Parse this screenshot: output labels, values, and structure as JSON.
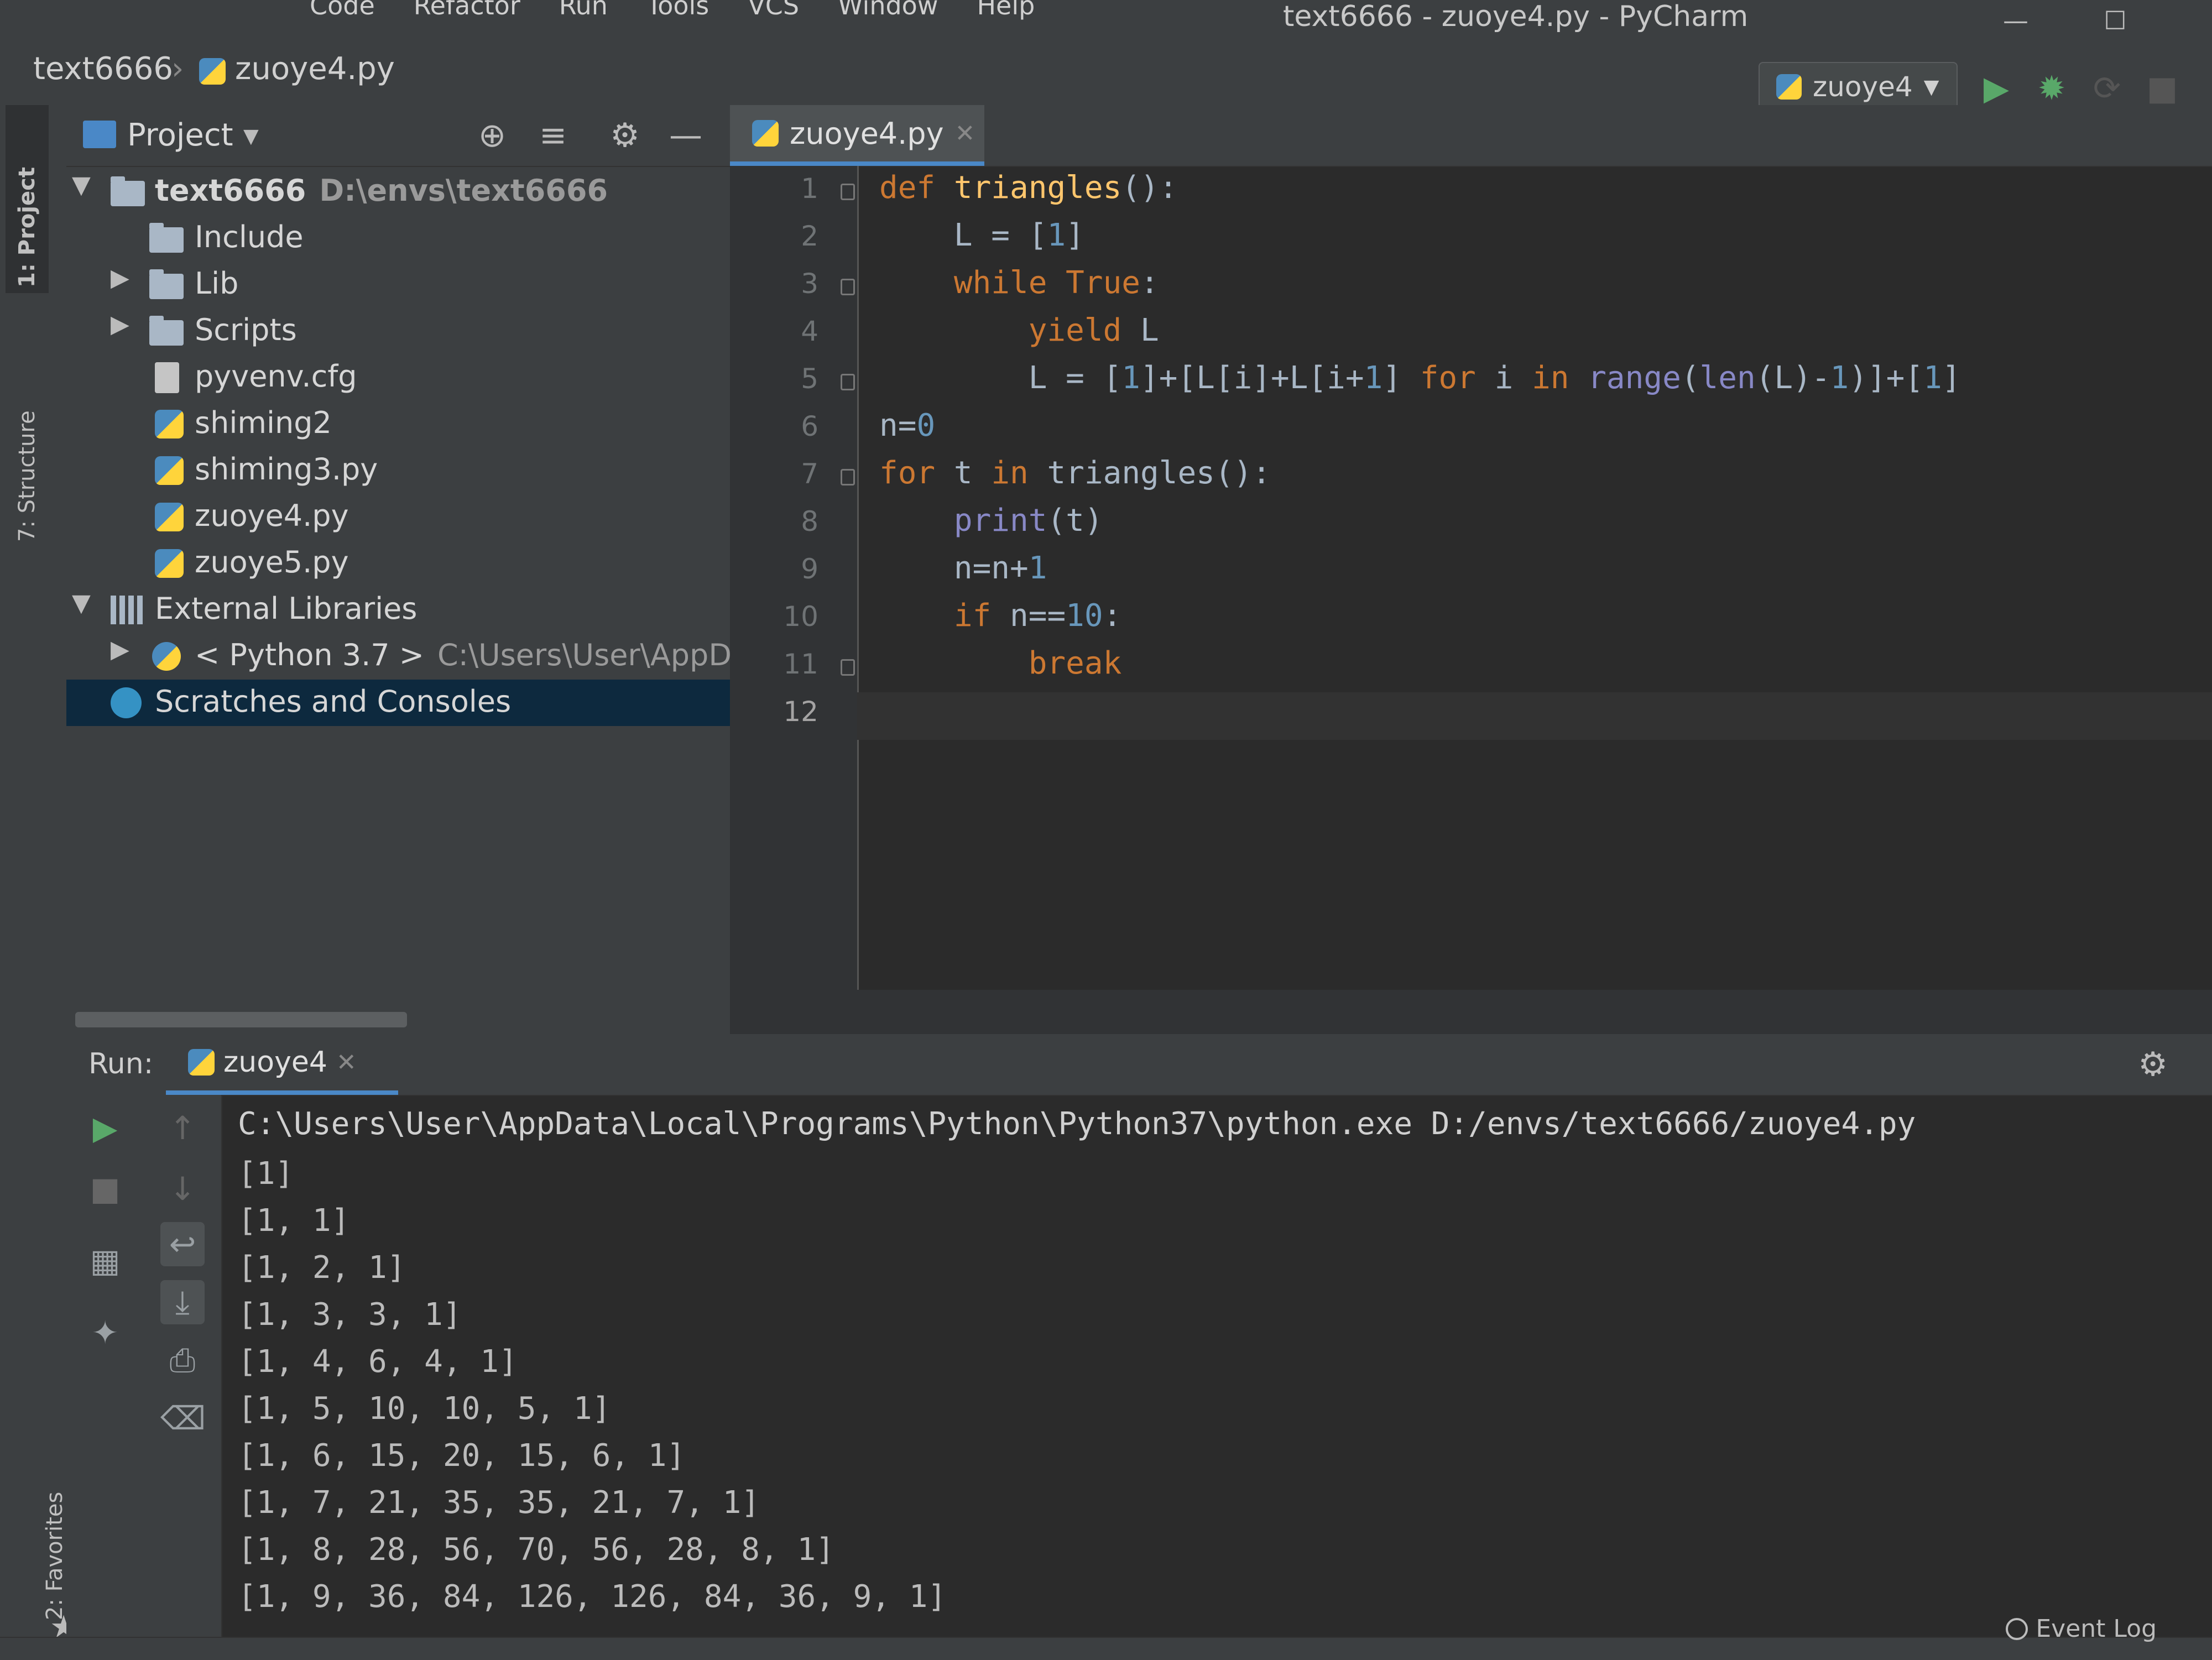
{
  "menu": {
    "items": [
      "Code",
      "Refactor",
      "Run",
      "Tools",
      "VCS",
      "Window",
      "Help"
    ],
    "window_title": "text6666 - zuoye4.py - PyCharm"
  },
  "breadcrumb": {
    "project": "text6666",
    "file": "zuoye4.py"
  },
  "run_config": {
    "name": "zuoye4"
  },
  "left_stripe": {
    "project_tab": "1: Project",
    "structure_tab": "7: Structure",
    "favorites_tab": "2: Favorites"
  },
  "project_panel": {
    "title": "Project",
    "tree": [
      {
        "label": "text6666",
        "path": "D:\\envs\\text6666"
      },
      {
        "label": "Include"
      },
      {
        "label": "Lib"
      },
      {
        "label": "Scripts"
      },
      {
        "label": "pyvenv.cfg"
      },
      {
        "label": "shiming2"
      },
      {
        "label": "shiming3.py"
      },
      {
        "label": "zuoye4.py"
      },
      {
        "label": "zuoye5.py"
      },
      {
        "label": "External Libraries"
      },
      {
        "label": "< Python 3.7 >",
        "path": "C:\\Users\\User\\AppData"
      },
      {
        "label": "Scratches and Consoles"
      }
    ]
  },
  "editor": {
    "tab_label": "zuoye4.py",
    "line_numbers": [
      "1",
      "2",
      "3",
      "4",
      "5",
      "6",
      "7",
      "8",
      "9",
      "10",
      "11",
      "12"
    ],
    "code": [
      "def triangles():",
      "    L = [1]",
      "    while True:",
      "        yield L",
      "        L = [1]+[L[i]+L[i+1] for i in range(len(L)-1)]+[1]",
      "n=0",
      "for t in triangles():",
      "    print(t)",
      "    n=n+1",
      "    if n==10:",
      "        break",
      ""
    ]
  },
  "run": {
    "label": "Run:",
    "tab_label": "zuoye4",
    "command": "C:\\Users\\User\\AppData\\Local\\Programs\\Python\\Python37\\python.exe D:/envs/text6666/zuoye4.py",
    "output": [
      "[1]",
      "[1, 1]",
      "[1, 2, 1]",
      "[1, 3, 3, 1]",
      "[1, 4, 6, 4, 1]",
      "[1, 5, 10, 10, 5, 1]",
      "[1, 6, 15, 20, 15, 6, 1]",
      "[1, 7, 21, 35, 35, 21, 7, 1]",
      "[1, 8, 28, 56, 70, 56, 28, 8, 1]",
      "[1, 9, 36, 84, 126, 126, 84, 36, 9, 1]"
    ]
  },
  "status": {
    "event_log": "Event Log"
  },
  "colors": {
    "keyword": "#cc7832",
    "function": "#ffc66d",
    "number": "#6897bb",
    "selection": "#0d293e",
    "accent": "#4a88c7"
  }
}
